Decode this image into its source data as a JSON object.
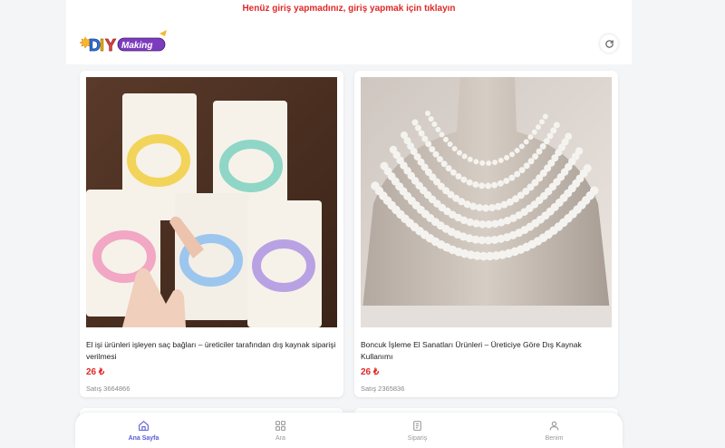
{
  "header": {
    "notice": "Henüz giriş yapmadınız, giriş yapmak için tıklayın",
    "logo_text": "DIY Making"
  },
  "products": [
    {
      "title": "El işi ürünleri işleyen saç bağları – üreticiler tarafından dış kaynak siparişi verilmesi",
      "price": "26 ₺",
      "sales": "Satış 3664866"
    },
    {
      "title": "Boncuk İşleme El Sanatları Ürünleri – Üreticiye Göre Dış Kaynak Kullanımı",
      "price": "26 ₺",
      "sales": "Satış 2365836"
    }
  ],
  "tabbar": {
    "items": [
      {
        "label": "Ana Sayfa",
        "icon": "home-icon",
        "active": true
      },
      {
        "label": "Ara",
        "icon": "grid-icon",
        "active": false
      },
      {
        "label": "Sipariş",
        "icon": "document-icon",
        "active": false
      },
      {
        "label": "Benim",
        "icon": "user-icon",
        "active": false
      }
    ]
  },
  "colors": {
    "accent": "#5b5bd6",
    "price": "#e02828",
    "notice": "#e02828"
  }
}
